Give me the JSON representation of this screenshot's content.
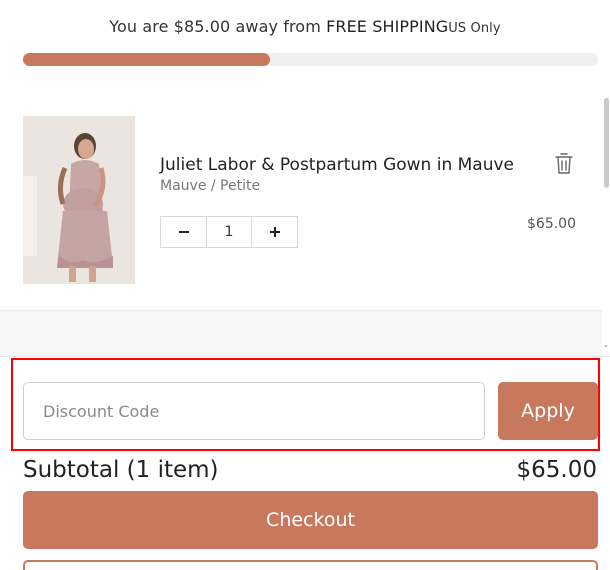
{
  "shipping": {
    "prefix": "You are $85.00 away from",
    "emphasis": "FREE SHIPPING",
    "region": "US Only",
    "progress_fraction": 0.43
  },
  "item": {
    "title": "Juliet Labor & Postpartum Gown in Mauve",
    "variant": "Mauve / Petite",
    "quantity": "1",
    "price": "$65.00",
    "icons": {
      "delete": "trash-icon",
      "decrease": "minus-icon",
      "increase": "plus-icon"
    }
  },
  "discount": {
    "placeholder": "Discount Code",
    "apply_label": "Apply"
  },
  "summary": {
    "subtotal_label": "Subtotal (1 item)",
    "subtotal_amount": "$65.00"
  },
  "checkout": {
    "label": "Checkout"
  },
  "colors": {
    "accent": "#c8795d",
    "track": "#efefef",
    "highlight": "#ff0000"
  }
}
